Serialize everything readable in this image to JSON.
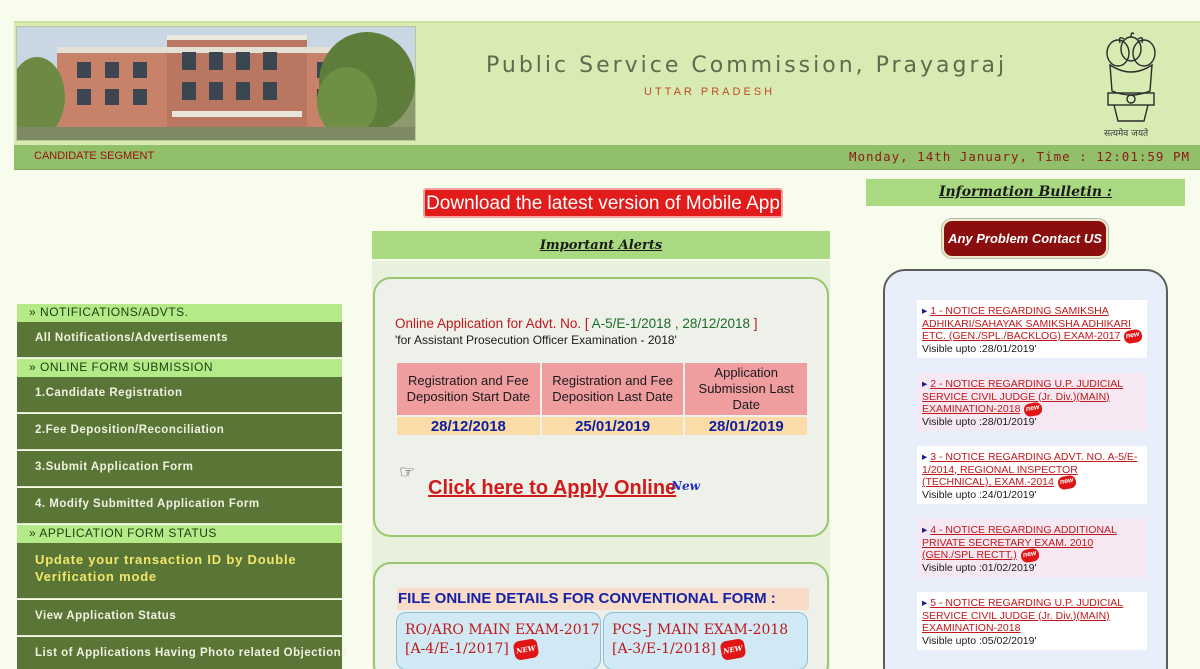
{
  "header": {
    "title": "Public Service Commission, Prayagraj",
    "subtitle": "UTTAR PRADESH",
    "motto": "सत्यमेव जयते"
  },
  "segment_bar": {
    "label": "CANDIDATE SEGMENT",
    "datetime": "Monday, 14th January, Time : 12:01:59 PM"
  },
  "left_menu": {
    "sections": [
      {
        "heading": "NOTIFICATIONS/ADVTS.",
        "items": [
          "All Notifications/Advertisements"
        ]
      },
      {
        "heading": "ONLINE FORM SUBMISSION",
        "items": [
          "1.Candidate Registration",
          "2.Fee Deposition/Reconciliation",
          "3.Submit Application Form",
          "4. Modify Submitted Application Form"
        ]
      },
      {
        "heading": "APPLICATION FORM STATUS",
        "items": [
          "Update your transaction ID by Double Verification mode",
          "View Application Status",
          "List of Applications Having Photo related Objections"
        ]
      }
    ]
  },
  "center": {
    "mobile_app_button": "Download the latest version of Mobile App",
    "alerts_heading": "Important Alerts",
    "advt": {
      "prefix": "Online Application for Advt. No. [",
      "number": "A-5/E-1/2018 , 28/12/2018",
      "suffix": "]",
      "description": "'for Assistant Prosecution Officer Examination - 2018'"
    },
    "dates_table": {
      "headers": [
        "Registration and Fee Deposition Start Date",
        "Registration and Fee Deposition Last Date",
        "Application Submission Last Date"
      ],
      "values": [
        "28/12/2018",
        "25/01/2019",
        "28/01/2019"
      ]
    },
    "hand_icon": "☞",
    "apply_link": "Click here to Apply Online",
    "apply_badge": "New",
    "file_online_title": "FILE ONLINE DETAILS FOR CONVENTIONAL FORM :",
    "exams": [
      {
        "line1": "RO/ARO MAIN EXAM-2017",
        "line2": "[A-4/E-1/2017]",
        "badge": "NEW"
      },
      {
        "line1": "PCS-J MAIN EXAM-2018",
        "line2": "[A-3/E-1/2018]",
        "badge": "NEW"
      }
    ]
  },
  "right": {
    "info_heading": "Information Bulletin :",
    "contact_button": "Any Problem Contact US",
    "notices": [
      {
        "marker": "▸",
        "text": "1 - NOTICE REGARDING SAMIKSHA ADHIKARI/SAHAYAK SAMIKSHA ADHIKARI ETC. (GEN./SPL./BACKLOG) EXAM-2017",
        "badge": "new",
        "visible": "Visible upto :28/01/2019'"
      },
      {
        "marker": "▸",
        "text": "2 - NOTICE REGARDING U.P. JUDICIAL SERVICE CIVIL JUDGE (Jr. Div.)(MAIN) EXAMINATION-2018",
        "badge": "new",
        "visible": "Visible upto :28/01/2019'"
      },
      {
        "marker": "▸",
        "text": "3 - NOTICE REGARDING ADVT. NO. A-5/E-1/2014, REGIONAL INSPECTOR (TECHNICAL), EXAM.-2014",
        "badge": "new",
        "visible": "Visible upto :24/01/2019'"
      },
      {
        "marker": "▸",
        "text": "4 - NOTICE REGARDING ADDITIONAL PRIVATE SECRETARY EXAM. 2010 (GEN./SPL RECTT.)",
        "badge": "new",
        "visible": "Visible upto :01/02/2019'"
      },
      {
        "marker": "▸",
        "text": "5 - NOTICE REGARDING U.P. JUDICIAL SERVICE CIVIL JUDGE (Jr. Div.)(MAIN) EXAMINATION-2018",
        "badge": "",
        "visible": "Visible upto :05/02/2019'"
      }
    ]
  }
}
